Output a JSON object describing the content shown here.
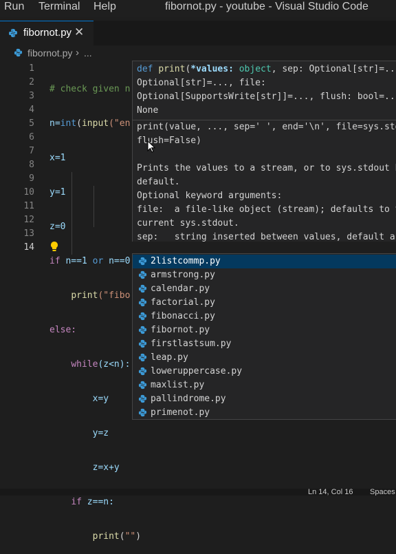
{
  "menu": [
    "Run",
    "Terminal",
    "Help"
  ],
  "window_title": "fibornot.py - youtube - Visual Studio Code",
  "tab": {
    "name": "fibornot.py",
    "close": "✕"
  },
  "breadcrumb": {
    "file": "fibornot.py",
    "chevron": "›",
    "more": "..."
  },
  "line_numbers": [
    "1",
    "2",
    "3",
    "4",
    "5",
    "6",
    "7",
    "8",
    "9",
    "10",
    "11",
    "12",
    "13",
    "14"
  ],
  "code": {
    "l1": "# check given n",
    "l2a": "n=",
    "l2b": "int",
    "l2c": "(",
    "l2d": "input",
    "l2e": "(\"en",
    "l3": "x=1",
    "l4": "y=1",
    "l5": "z=0",
    "l6a": "if",
    "l6b": " n==1 ",
    "l6c": "or",
    "l6d": " n==0",
    "l7a": "print",
    "l7b": "(\"fibo",
    "l8": "else:",
    "l9a": "while",
    "l9b": "(z<n):",
    "l10": "x=y",
    "l11": "y=z",
    "l12": "z=x+y",
    "l13a": "if",
    "l13b": " z==n:",
    "l14a": "print",
    "l14b": "(",
    "l14c": "\"\"",
    "l14d": ")"
  },
  "hover": {
    "sig1a": "def ",
    "sig1b": "print",
    "sig1c": "(",
    "sig1d": "*values: ",
    "sig1e": "object",
    "sig1f": ", sep: Optional[str]=...,",
    "sig2": "Optional[str]=..., file:",
    "sig3": "Optional[SupportsWrite[str]]=..., flush: bool=...)",
    "sig4": "None",
    "doc1": "print(value, ..., sep=' ', end='\\n', file=sys.std",
    "doc2": "flush=False)",
    "doc3": "Prints the values to a stream, or to sys.stdout by",
    "doc4": "default.",
    "doc5": "Optional keyword arguments:",
    "doc6": "file:  a file-like object (stream); defaults to the",
    "doc7": "current sys.stdout.",
    "doc8": "sep:   string inserted between values, default a"
  },
  "suggestions": [
    "2listcommp.py",
    "armstrong.py",
    "calendar.py",
    "factorial.py",
    "fibonacci.py",
    "fibornot.py",
    "firstlastsum.py",
    "leap.py",
    "loweruppercase.py",
    "maxlist.py",
    "pallindrome.py",
    "primenot.py"
  ],
  "selected_suggestion": "2listcommp.py",
  "status": {
    "position": "Ln 14, Col 16",
    "spaces": "Spaces"
  },
  "colors": {
    "accent": "#0078d4",
    "selection": "#04395e",
    "python_icon": "#3c9bd8"
  }
}
